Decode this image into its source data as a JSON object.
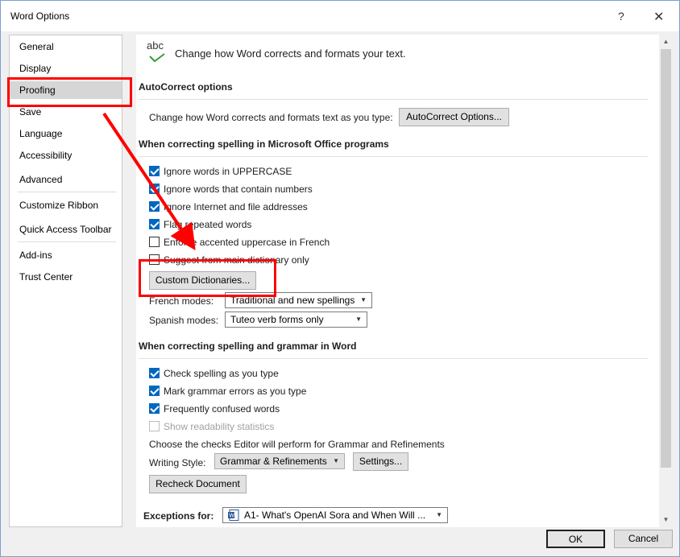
{
  "window": {
    "title": "Word Options",
    "help_glyph": "?",
    "close_glyph": "✕"
  },
  "nav": {
    "items": [
      {
        "label": "General"
      },
      {
        "label": "Display"
      },
      {
        "label": "Proofing",
        "selected": true
      },
      {
        "label": "Save"
      },
      {
        "label": "Language"
      },
      {
        "label": "Accessibility"
      },
      {
        "label": "Advanced"
      },
      {
        "label": "Customize Ribbon"
      },
      {
        "label": "Quick Access Toolbar"
      },
      {
        "label": "Add-ins"
      },
      {
        "label": "Trust Center"
      }
    ]
  },
  "header": {
    "icon_text": "abc",
    "description": "Change how Word corrects and formats your text."
  },
  "autocorrect": {
    "title": "AutoCorrect options",
    "description": "Change how Word corrects and formats text as you type:",
    "button": "AutoCorrect Options..."
  },
  "office_spelling": {
    "title": "When correcting spelling in Microsoft Office programs",
    "options": [
      {
        "label": "Ignore words in UPPERCASE",
        "checked": true
      },
      {
        "label": "Ignore words that contain numbers",
        "checked": true
      },
      {
        "label": "Ignore Internet and file addresses",
        "checked": true
      },
      {
        "label": "Flag repeated words",
        "checked": true
      },
      {
        "label": "Enforce accented uppercase in French",
        "checked": false
      },
      {
        "label": "Suggest from main dictionary only",
        "checked": false
      }
    ],
    "custom_dict_button": "Custom Dictionaries...",
    "french_label": "French modes:",
    "french_value": "Traditional and new spellings",
    "spanish_label": "Spanish modes:",
    "spanish_value": "Tuteo verb forms only"
  },
  "word_spelling": {
    "title": "When correcting spelling and grammar in Word",
    "options": [
      {
        "label": "Check spelling as you type",
        "checked": true,
        "disabled": false
      },
      {
        "label": "Mark grammar errors as you type",
        "checked": true,
        "disabled": false
      },
      {
        "label": "Frequently confused words",
        "checked": true,
        "disabled": false
      },
      {
        "label": "Show readability statistics",
        "checked": false,
        "disabled": true
      }
    ],
    "checks_description": "Choose the checks Editor will perform for Grammar and Refinements",
    "writing_style_label": "Writing Style:",
    "writing_style_value": "Grammar & Refinements",
    "settings_button": "Settings...",
    "recheck_button": "Recheck Document"
  },
  "exceptions": {
    "label": "Exceptions for:",
    "value": "A1- What's OpenAI Sora and When Will ..."
  },
  "footer": {
    "ok": "OK",
    "cancel": "Cancel"
  },
  "annotation": {
    "color": "#ff0000"
  }
}
